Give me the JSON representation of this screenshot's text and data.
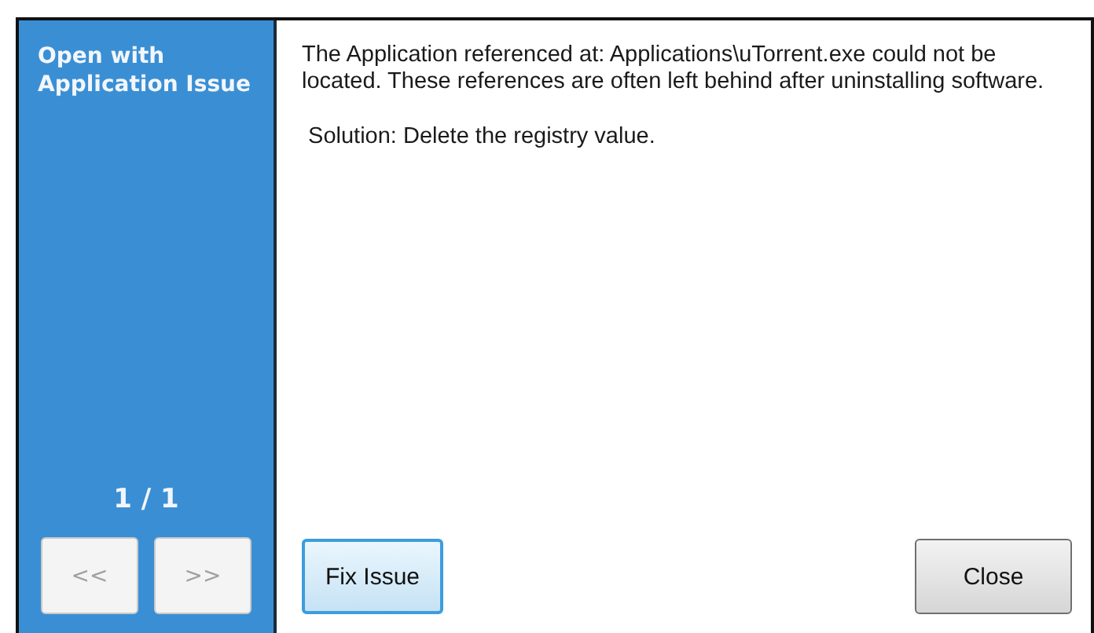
{
  "sidebar": {
    "title": "Open with Application Issue",
    "counter": "1 / 1",
    "nav_buttons": [
      {
        "label": "<<",
        "disabled": true
      },
      {
        "label": ">>",
        "disabled": true
      }
    ]
  },
  "content": {
    "paragraphs": [
      "The Application referenced at: Applications\\uTorrent.exe could not be located. These references are often left behind after uninstalling software.",
      " Solution: Delete the registry value."
    ]
  },
  "buttons": [
    {
      "label": "Fix Issue",
      "focused": true
    },
    {
      "label": "Close",
      "focused": false
    }
  ]
}
